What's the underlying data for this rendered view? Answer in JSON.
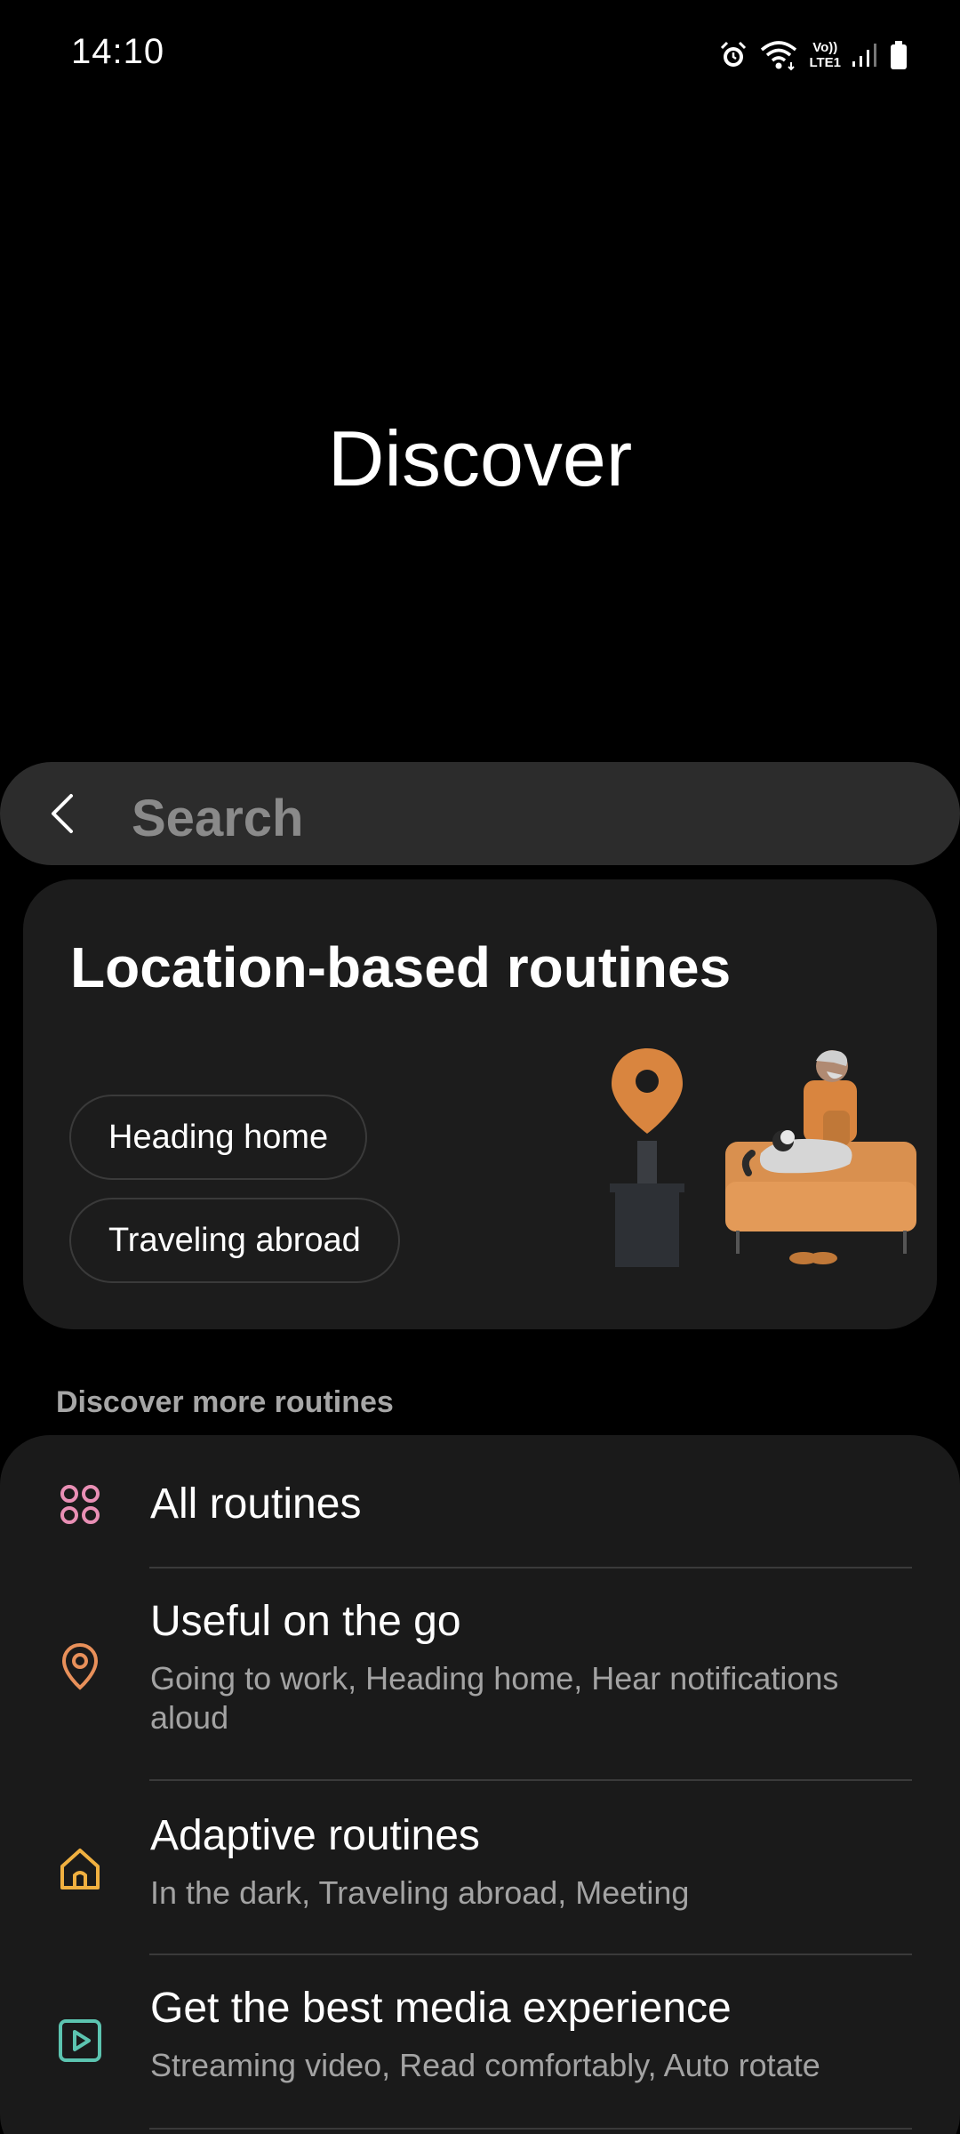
{
  "status_bar": {
    "time": "14:10",
    "icons": [
      "alarm-icon",
      "wifi-icon",
      "volte-lte-icon",
      "signal-icon",
      "battery-icon"
    ],
    "volte_text_top": "Vo))",
    "volte_text_bottom": "LTE1"
  },
  "page": {
    "title": "Discover"
  },
  "search": {
    "placeholder": "Search",
    "back_icon": "chevron-left-icon"
  },
  "location_card": {
    "title": "Location-based routines",
    "chips": [
      "Heading home",
      "Traveling abroad"
    ]
  },
  "discover_more": {
    "header": "Discover more routines",
    "items": [
      {
        "title": "All routines",
        "subtitle": "",
        "icon": "grid-icon",
        "icon_color": "#e98fb5"
      },
      {
        "title": "Useful on the go",
        "subtitle": "Going to work, Heading home, Hear notifications aloud",
        "icon": "location-pin-icon",
        "icon_color": "#e8905a"
      },
      {
        "title": "Adaptive routines",
        "subtitle": "In the dark, Traveling abroad, Meeting",
        "icon": "home-icon",
        "icon_color": "#f0b040"
      },
      {
        "title": "Get the best media experience",
        "subtitle": "Streaming video, Read comfortably, Auto rotate",
        "icon": "play-icon",
        "icon_color": "#5cc4b0"
      }
    ]
  },
  "colors": {
    "background": "#000000",
    "card": "#1c1c1c",
    "search_bar": "#2c2c2c",
    "secondary_text": "#a3a3a3",
    "accent_orange": "#d88a4a"
  }
}
